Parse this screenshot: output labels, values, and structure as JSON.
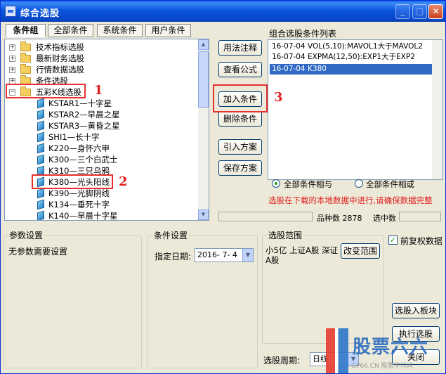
{
  "window": {
    "title": "综合选股"
  },
  "titlebar_buttons": {
    "minimize": "_",
    "maximize": "□",
    "close": "✕"
  },
  "tabs": [
    {
      "label": "条件组"
    },
    {
      "label": "全部条件"
    },
    {
      "label": "系统条件"
    },
    {
      "label": "用户条件"
    }
  ],
  "tree": {
    "expand_symbol": "+",
    "collapse_symbol": "−",
    "folders": [
      {
        "label": "技术指标选股"
      },
      {
        "label": "最新财务选股"
      },
      {
        "label": "行情数据选股"
      },
      {
        "label": "条件选股"
      },
      {
        "label": "五彩K线选股"
      }
    ],
    "leaves": [
      {
        "label": "KSTAR1—十字星"
      },
      {
        "label": "KSTAR2—早晨之星"
      },
      {
        "label": "KSTAR3—黄昏之星"
      },
      {
        "label": "SHI1—长十字"
      },
      {
        "label": "K220—身怀六甲"
      },
      {
        "label": "K300—三个白武士"
      },
      {
        "label": "K310—三只乌鸦"
      },
      {
        "label": "K380—光头阳线"
      },
      {
        "label": "K390—光脚阴线"
      },
      {
        "label": "K134—垂死十字"
      },
      {
        "label": "K140—早晨十字星"
      }
    ]
  },
  "buttons": {
    "usage": "用法注释",
    "view_formula": "查看公式",
    "add_condition": "加入条件",
    "delete_condition": "删除条件",
    "import_plan": "引入方案",
    "save_plan": "保存方案",
    "change_range": "改变范围",
    "add_to_block": "选股入板块",
    "execute": "执行选股",
    "close": "关闭"
  },
  "conditions_panel": {
    "title": "组合选股条件列表",
    "items": [
      "16-07-04 VOL(5,10):MAVOL1大于MAVOL2",
      "16-07-04 EXPMA(12,50):EXP1大于EXP2",
      "16-07-04 K380"
    ],
    "selected_index": 2
  },
  "logic": {
    "and_label": "全部条件相与",
    "or_label": "全部条件相或",
    "selected": "and"
  },
  "warning": "选股在下载的本地数据中进行,请确保数据完整",
  "stats": {
    "count_label": "品种数",
    "count_value": "2878",
    "selected_label": "选中数",
    "selected_value": ""
  },
  "params": {
    "title": "参数设置",
    "text": "无参数需要设置"
  },
  "cond_settings": {
    "title": "条件设置",
    "date_label": "指定日期:",
    "date_value": "2016- 7- 4"
  },
  "range": {
    "title": "选股范围",
    "text": "小5亿 上证A股 深证A股"
  },
  "restore_data": {
    "label": "前复权数据",
    "checked": true,
    "check_mark": "✓"
  },
  "period": {
    "label": "选股周期:",
    "value": "日线"
  },
  "annotations": [
    "1",
    "2",
    "3"
  ],
  "watermark": {
    "brand": "股票六六",
    "url": "GP66.CN 股票学习网"
  },
  "colors": {
    "accent_red": "#e8302f",
    "selection_blue": "#316ac5",
    "title_blue": "#0646c8"
  }
}
